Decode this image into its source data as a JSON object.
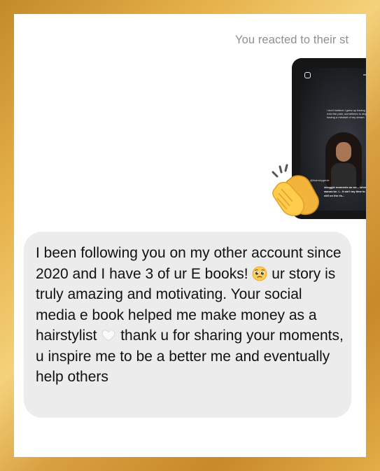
{
  "thread": {
    "reaction_note": "You reacted to their st",
    "reaction_emoji": "clapping-hands-icon"
  },
  "story_preview": {
    "caption": "i don't believe I grew up having to hold the pain, sometimes to stop having a mindset of my dream",
    "handle": "@ihairsbygenie",
    "bottom_text": "struggle moments as we... where they wanna be. I... it ain't my time to sh... yet, I'm still on the ris..."
  },
  "message": {
    "part1": "I been following you on my other account since 2020 and I have 3 of ur E books! ",
    "emoji1": "pleading-face-icon",
    "part2": " ur story is truly amazing and motivating. Your social media e book helped me make money as a hairstylist ",
    "emoji2": "white-heart-icon",
    "part3": " thank u for sharing your moments, u inspire me to be a better me and eventually help others"
  },
  "colors": {
    "frame_gold": "#e6b14a",
    "bubble_bg": "#ececec",
    "meta_text": "#8e8e93"
  }
}
